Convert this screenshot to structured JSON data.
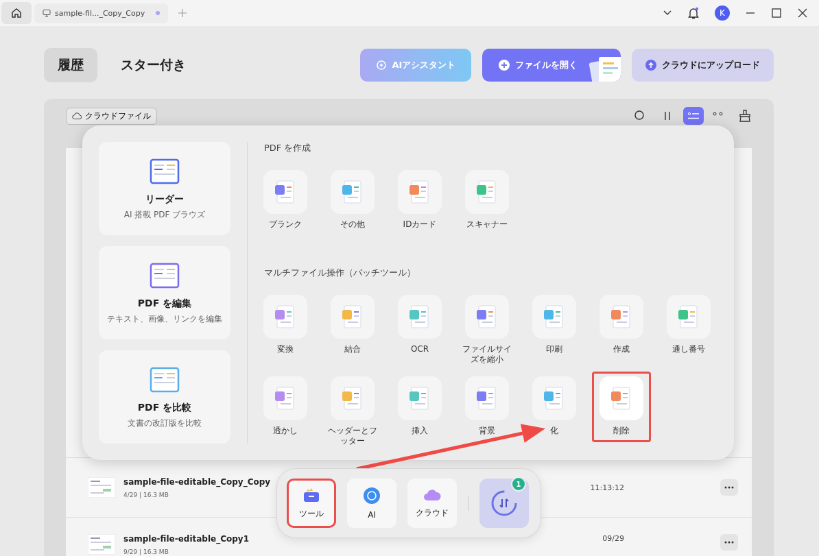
{
  "titlebar": {
    "tab_title": "sample-fil..._Copy_Copy",
    "avatar": "K"
  },
  "tabs": [
    {
      "label": "履歴",
      "selected": true
    },
    {
      "label": "スター付き",
      "selected": false
    }
  ],
  "actions": [
    {
      "label": "AIアシスタント",
      "kind": "ai"
    },
    {
      "label": "ファイルを開く",
      "kind": "open"
    },
    {
      "label": "クラウドにアップロード",
      "kind": "upload"
    }
  ],
  "cloud_files": {
    "label": "クラウドファイル"
  },
  "view_modes": [
    {
      "kind": "list",
      "selected": true
    },
    {
      "kind": "grid",
      "selected": false
    }
  ],
  "files": [
    {
      "name": "sample-file-editable_Copy_Copy",
      "meta": "4/29 | 16.3 MB",
      "time": "11:13:12"
    },
    {
      "name": "sample-file-editable_Copy1",
      "meta": "9/29 | 16.3 MB",
      "time": "09/29"
    }
  ],
  "popup": {
    "cards": [
      {
        "title": "リーダー",
        "subtitle": "AI 搭載 PDF ブラウズ",
        "kind": "reader"
      },
      {
        "title": "PDF を編集",
        "subtitle": "テキスト、画像、リンクを編集",
        "kind": "edit"
      },
      {
        "title": "PDF を比較",
        "subtitle": "文書の改訂版を比較",
        "kind": "compare"
      }
    ],
    "sections": [
      {
        "title": "PDF を作成",
        "tools": [
          {
            "label": "ブランク",
            "highlighted": false
          },
          {
            "label": "その他",
            "highlighted": false
          },
          {
            "label": "IDカード",
            "highlighted": false
          },
          {
            "label": "スキャナー",
            "highlighted": false
          }
        ]
      },
      {
        "title": "マルチファイル操作（バッチツール）",
        "tools": [
          {
            "label": "変換",
            "highlighted": false
          },
          {
            "label": "結合",
            "highlighted": false
          },
          {
            "label": "OCR",
            "highlighted": false
          },
          {
            "label": "ファイルサイズを縮小",
            "highlighted": false
          },
          {
            "label": "印刷",
            "highlighted": false
          },
          {
            "label": "作成",
            "highlighted": false
          },
          {
            "label": "通し番号",
            "highlighted": false
          },
          {
            "label": "透かし",
            "highlighted": false
          },
          {
            "label": "ヘッダーとフッター",
            "highlighted": false
          },
          {
            "label": "挿入",
            "highlighted": false
          },
          {
            "label": "背景",
            "highlighted": false
          },
          {
            "label": "化",
            "highlighted": false
          },
          {
            "label": "削除",
            "highlighted": true
          }
        ]
      }
    ]
  },
  "dock": [
    {
      "label": "ツール",
      "highlighted": true
    },
    {
      "label": "AI",
      "highlighted": false
    },
    {
      "label": "クラウド",
      "highlighted": false
    }
  ],
  "sync": {
    "badge": "1"
  }
}
